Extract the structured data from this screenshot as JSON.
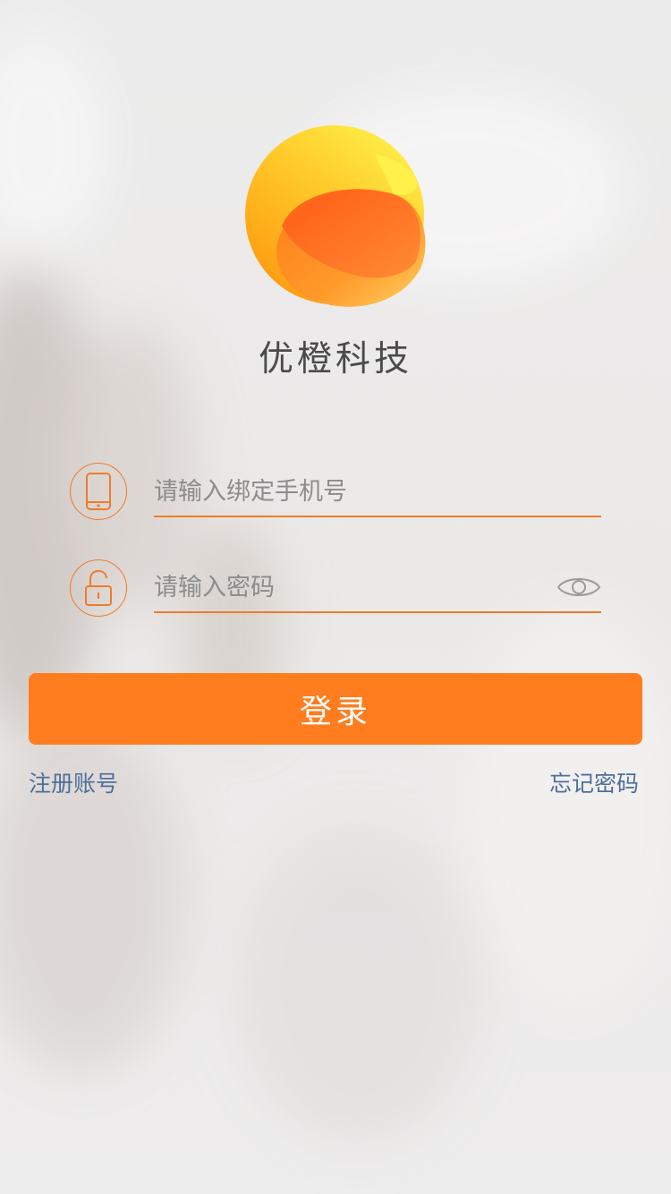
{
  "app": {
    "name": "优橙科技",
    "logo_icon": "orange-logo-icon"
  },
  "phone_field": {
    "icon": "phone-icon",
    "value": "",
    "placeholder": "请输入绑定手机号"
  },
  "password_field": {
    "icon": "unlock-icon",
    "value": "",
    "placeholder": "请输入密码",
    "toggle_icon": "eye-icon"
  },
  "login_button": {
    "label": "登录"
  },
  "links": {
    "register": "注册账号",
    "forgot_password": "忘记密码"
  },
  "colors": {
    "accent": "#ff7d1e",
    "link": "#4d6f9a",
    "title_text": "#4a4a4a",
    "placeholder": "#8c8c8c"
  }
}
